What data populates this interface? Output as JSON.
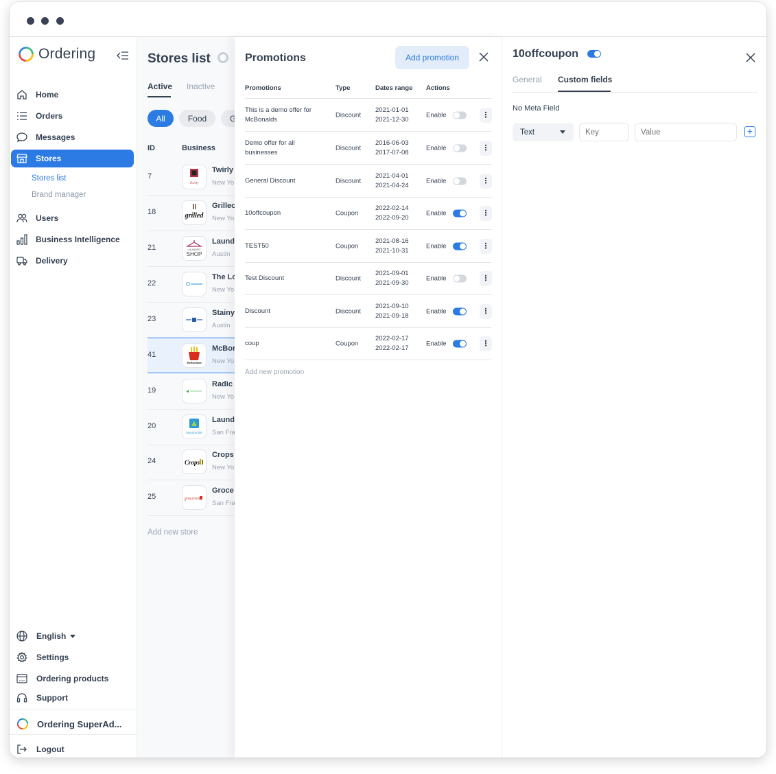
{
  "app": {
    "brand": "Ordering",
    "footer_brand": "Ordering SuperAd..."
  },
  "sidebar": {
    "items": [
      {
        "label": "Home",
        "icon": "home-icon"
      },
      {
        "label": "Orders",
        "icon": "list-icon"
      },
      {
        "label": "Messages",
        "icon": "chat-icon"
      },
      {
        "label": "Stores",
        "icon": "store-icon",
        "active": true
      },
      {
        "label": "Users",
        "icon": "users-icon"
      },
      {
        "label": "Business Intelligence",
        "icon": "bar-chart-icon"
      },
      {
        "label": "Delivery",
        "icon": "truck-icon"
      }
    ],
    "sub_items": [
      {
        "label": "Stores list",
        "active": true
      },
      {
        "label": "Brand manager"
      }
    ],
    "bottom": {
      "language": "English",
      "settings": "Settings",
      "products": "Ordering products",
      "support": "Support",
      "logout": "Logout"
    }
  },
  "stores": {
    "title": "Stores list",
    "tabs": [
      "Active",
      "Inactive"
    ],
    "filters": [
      "All",
      "Food",
      "G"
    ],
    "columns": {
      "id": "ID",
      "business": "Business"
    },
    "rows": [
      {
        "id": "7",
        "name": "Twirly",
        "city": "New Yo",
        "logo": "twirly-logo"
      },
      {
        "id": "18",
        "name": "Grillec",
        "city": "New Yo",
        "logo": "grilled-logo"
      },
      {
        "id": "21",
        "name": "Laund",
        "city": "Austin",
        "logo": "laundry-shop-logo"
      },
      {
        "id": "22",
        "name": "The Lc",
        "city": "New Yo",
        "logo": "laundry-home-logo"
      },
      {
        "id": "23",
        "name": "Stainy",
        "city": "Austin",
        "logo": "stainy-logo"
      },
      {
        "id": "41",
        "name": "McBor",
        "city": "New Yo",
        "logo": "mcbonalds-logo",
        "selected": true
      },
      {
        "id": "19",
        "name": "Radic",
        "city": "New Yo",
        "logo": "radicals-logo"
      },
      {
        "id": "20",
        "name": "Laund",
        "city": "San Fra",
        "logo": "laundry-cafe-logo"
      },
      {
        "id": "24",
        "name": "Crops",
        "city": "New Yo",
        "logo": "crops-logo"
      },
      {
        "id": "25",
        "name": "Groce",
        "city": "San Fra",
        "logo": "groceries-logo"
      }
    ],
    "add_label": "Add new store"
  },
  "promotions": {
    "title": "Promotions",
    "add_button": "Add promotion",
    "columns": {
      "name": "Promotions",
      "type": "Type",
      "dates": "Dates range",
      "actions": "Actions"
    },
    "rows": [
      {
        "name": "This is a demo offer for McBonalds",
        "type": "Discount",
        "start": "2021-01-01",
        "end": "2021-12-30",
        "status": "Enable",
        "on": false
      },
      {
        "name": "Demo offer for all businesses",
        "type": "Discount",
        "start": "2016-06-03",
        "end": "2017-07-08",
        "status": "Enable",
        "on": false
      },
      {
        "name": "General Discount",
        "type": "Discount",
        "start": "2021-04-01",
        "end": "2021-04-24",
        "status": "Enable",
        "on": false
      },
      {
        "name": "10offcoupon",
        "type": "Coupon",
        "start": "2022-02-14",
        "end": "2022-09-20",
        "status": "Enable",
        "on": true
      },
      {
        "name": "TEST50",
        "type": "Coupon",
        "start": "2021-08-16",
        "end": "2021-10-31",
        "status": "Enable",
        "on": true
      },
      {
        "name": "Test Discount",
        "type": "Discount",
        "start": "2021-09-01",
        "end": "2021-09-30",
        "status": "Enable",
        "on": false
      },
      {
        "name": "Discount",
        "type": "Discount",
        "start": "2021-09-10",
        "end": "2021-09-18",
        "status": "Enable",
        "on": true
      },
      {
        "name": "coup",
        "type": "Coupon",
        "start": "2022-02-17",
        "end": "2022-02-17",
        "status": "Enable",
        "on": true
      }
    ],
    "add_label": "Add new promotion"
  },
  "details": {
    "title": "10offcoupon",
    "tabs": [
      "General",
      "Custom fields"
    ],
    "active_tab": "Custom fields",
    "empty_text": "No Meta Field",
    "type_select": "Text",
    "key_placeholder": "Key",
    "value_placeholder": "Value"
  },
  "colors": {
    "accent": "#2c7be5",
    "text": "#344050",
    "muted": "#9aa3b2"
  }
}
